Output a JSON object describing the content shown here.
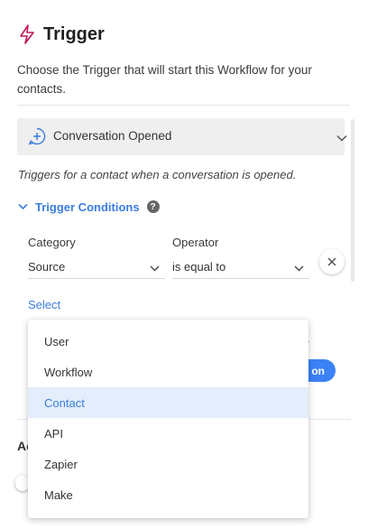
{
  "header": {
    "title": "Trigger",
    "icon": "lightning-bolt-icon",
    "icon_color": "#c2185b"
  },
  "description": "Choose the Trigger that will start this Workflow for your contacts.",
  "trigger": {
    "name": "Conversation Opened",
    "icon": "plus-circle-icon"
  },
  "trigger_note": "Triggers for a contact when a conversation is opened.",
  "conditions": {
    "title": "Trigger Conditions",
    "help": "?",
    "category_label": "Category",
    "category_value": "Source",
    "operator_label": "Operator",
    "operator_value": "is equal to",
    "value_placeholder": "Select"
  },
  "action_button_label": "on",
  "background_label": "Ac",
  "dropdown": {
    "options": [
      "User",
      "Workflow",
      "Contact",
      "API",
      "Zapier",
      "Make"
    ],
    "highlighted": "Contact"
  },
  "colors": {
    "accent": "#3b7ddd",
    "button": "#3b82f6",
    "highlight_bg": "#e3edfb"
  }
}
